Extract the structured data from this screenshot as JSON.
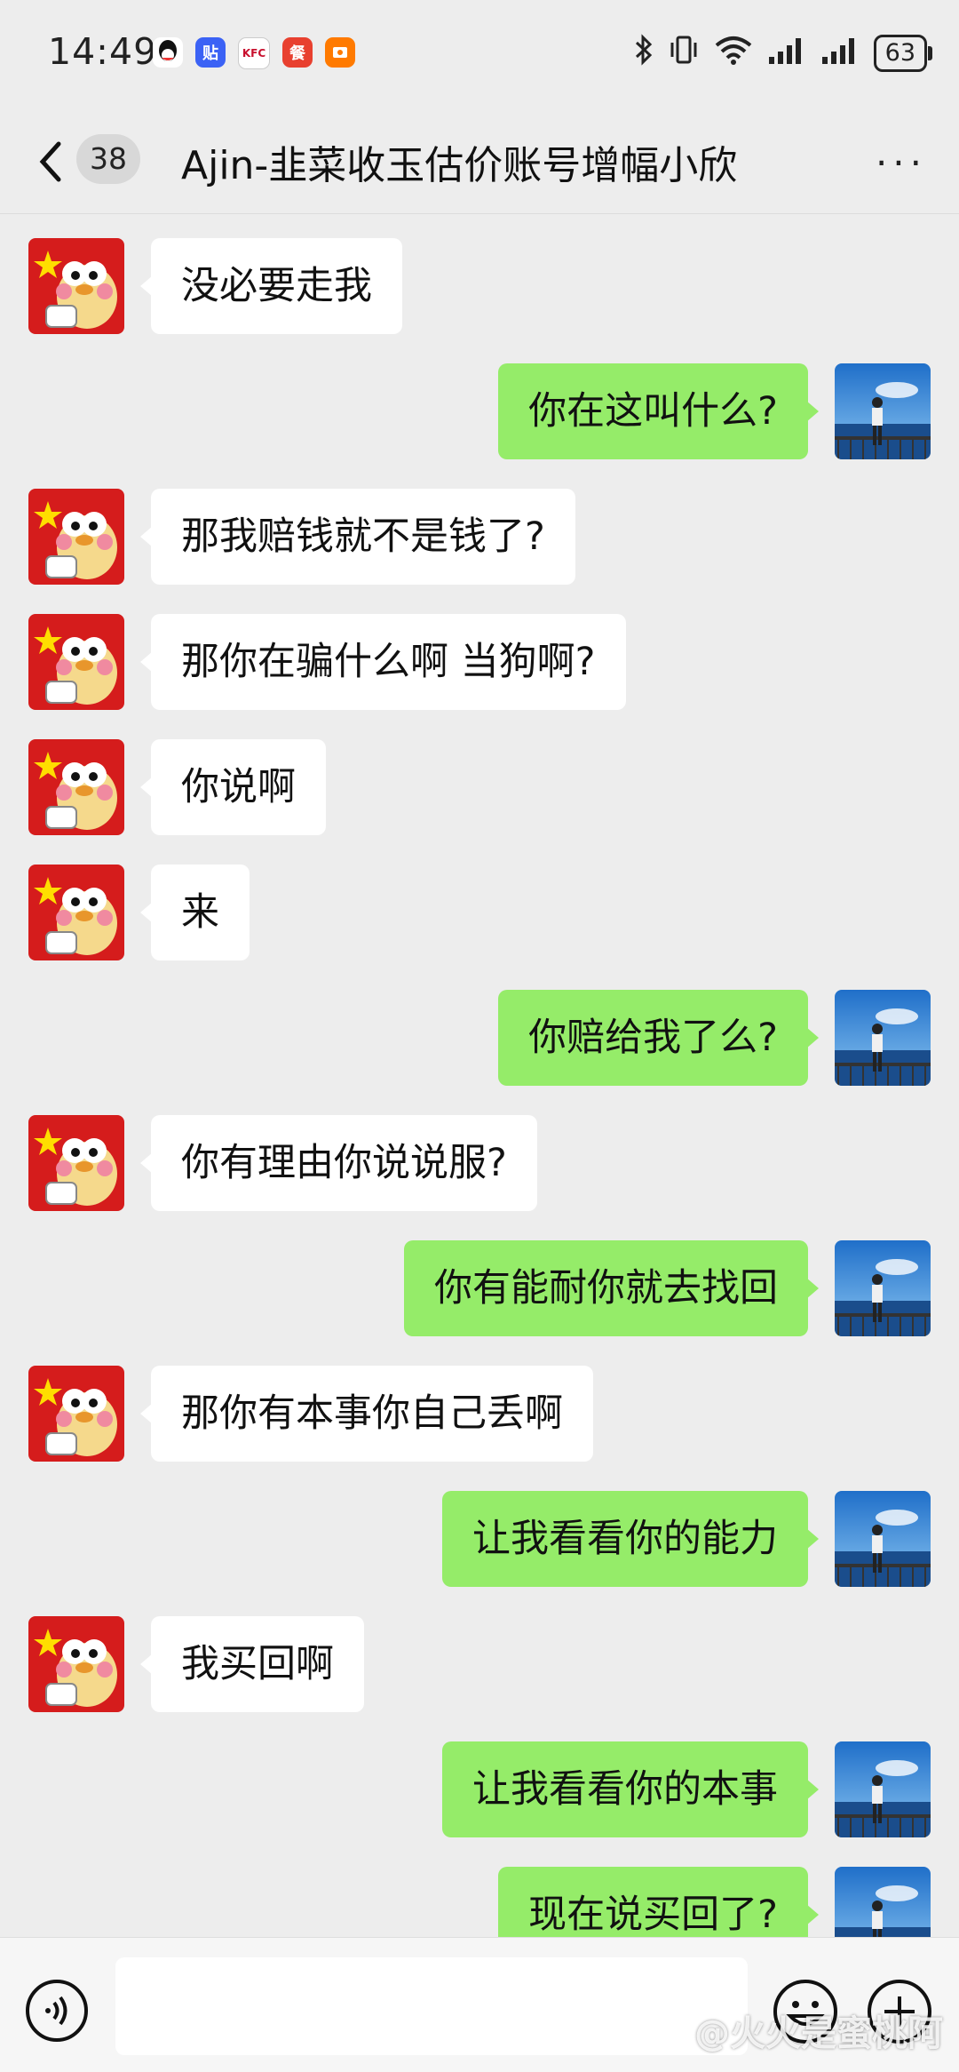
{
  "status_bar": {
    "time": "14:49",
    "battery": "63"
  },
  "header": {
    "back_count": "38",
    "title": "Ajin-韭菜收玉估价账号增幅小欣",
    "more": "···"
  },
  "colors": {
    "background": "#ededed",
    "incoming_bubble": "#ffffff",
    "outgoing_bubble": "#95ec69"
  },
  "messages": [
    {
      "side": "left",
      "text": "没必要走我"
    },
    {
      "side": "right",
      "text": "你在这叫什么?"
    },
    {
      "side": "left",
      "text": "那我赔钱就不是钱了?"
    },
    {
      "side": "left",
      "text": "那你在骗什么啊 当狗啊?"
    },
    {
      "side": "left",
      "text": "你说啊"
    },
    {
      "side": "left",
      "text": "来"
    },
    {
      "side": "right",
      "text": "你赔给我了么?"
    },
    {
      "side": "left",
      "text": "你有理由你说说服?"
    },
    {
      "side": "right",
      "text": "你有能耐你就去找回"
    },
    {
      "side": "left",
      "text": "那你有本事你自己丢啊"
    },
    {
      "side": "right",
      "text": "让我看看你的能力"
    },
    {
      "side": "left",
      "text": "我买回啊"
    },
    {
      "side": "right",
      "text": "让我看看你的本事"
    },
    {
      "side": "right",
      "text": "现在说买回了?"
    }
  ],
  "watermark": "@火火是蜜桃阿"
}
